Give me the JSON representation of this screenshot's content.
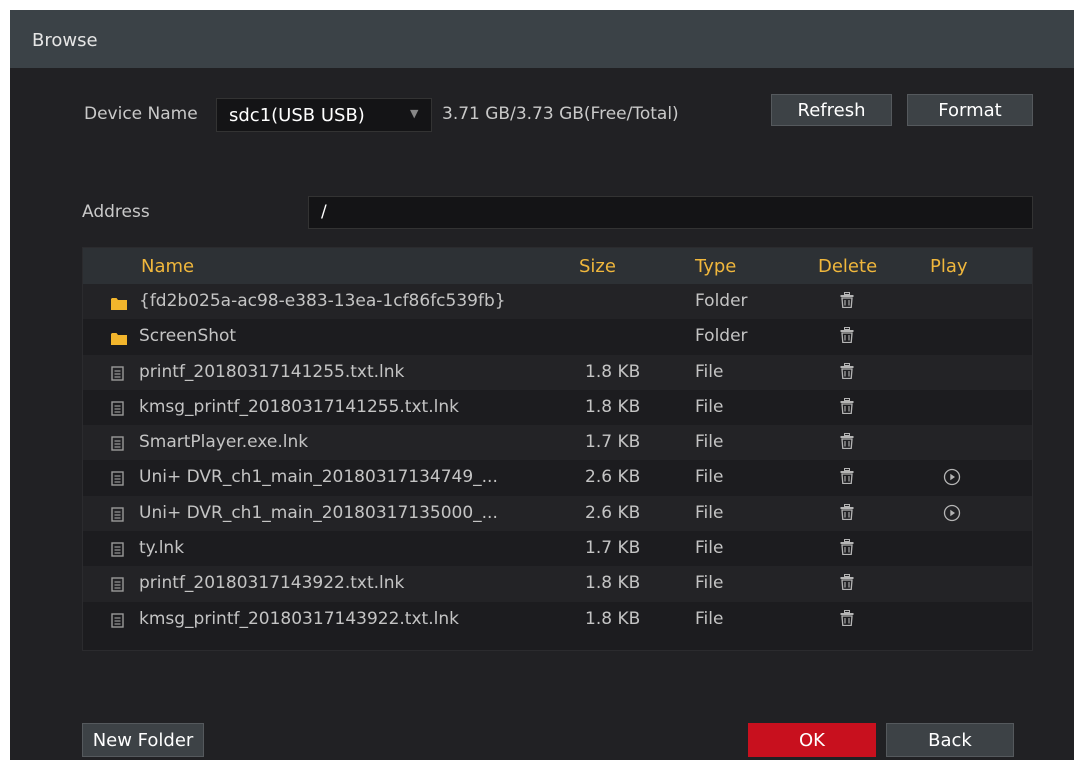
{
  "window": {
    "title": "Browse"
  },
  "device": {
    "label": "Device Name",
    "selected": "sdc1(USB USB)",
    "capacity": "3.71 GB/3.73 GB(Free/Total)",
    "refresh_label": "Refresh",
    "format_label": "Format"
  },
  "address": {
    "label": "Address",
    "value": "/"
  },
  "table": {
    "columns": [
      "Name",
      "Size",
      "Type",
      "Delete",
      "Play"
    ],
    "rows": [
      {
        "icon": "folder-icon",
        "name": "{fd2b025a-ac98-e383-13ea-1cf86fc539fb}",
        "size": "",
        "type": "Folder",
        "playable": false
      },
      {
        "icon": "folder-icon",
        "name": "ScreenShot",
        "size": "",
        "type": "Folder",
        "playable": false
      },
      {
        "icon": "file-icon",
        "name": "printf_20180317141255.txt.lnk",
        "size": "1.8 KB",
        "type": "File",
        "playable": false
      },
      {
        "icon": "file-icon",
        "name": "kmsg_printf_20180317141255.txt.lnk",
        "size": "1.8 KB",
        "type": "File",
        "playable": false
      },
      {
        "icon": "file-icon",
        "name": "SmartPlayer.exe.lnk",
        "size": "1.7 KB",
        "type": "File",
        "playable": false
      },
      {
        "icon": "file-icon",
        "name": "Uni+ DVR_ch1_main_20180317134749_...",
        "size": "2.6 KB",
        "type": "File",
        "playable": true
      },
      {
        "icon": "file-icon",
        "name": "Uni+ DVR_ch1_main_20180317135000_...",
        "size": "2.6 KB",
        "type": "File",
        "playable": true
      },
      {
        "icon": "file-icon",
        "name": "ty.lnk",
        "size": "1.7 KB",
        "type": "File",
        "playable": false
      },
      {
        "icon": "file-icon",
        "name": "printf_20180317143922.txt.lnk",
        "size": "1.8 KB",
        "type": "File",
        "playable": false
      },
      {
        "icon": "file-icon",
        "name": "kmsg_printf_20180317143922.txt.lnk",
        "size": "1.8 KB",
        "type": "File",
        "playable": false
      }
    ]
  },
  "footer": {
    "new_folder_label": "New Folder",
    "ok_label": "OK",
    "back_label": "Back"
  },
  "colors": {
    "header_text": "#f0b73c",
    "ok_button": "#c8101e",
    "folder_icon": "#f2b52c",
    "file_icon": "#9a9a9a"
  }
}
